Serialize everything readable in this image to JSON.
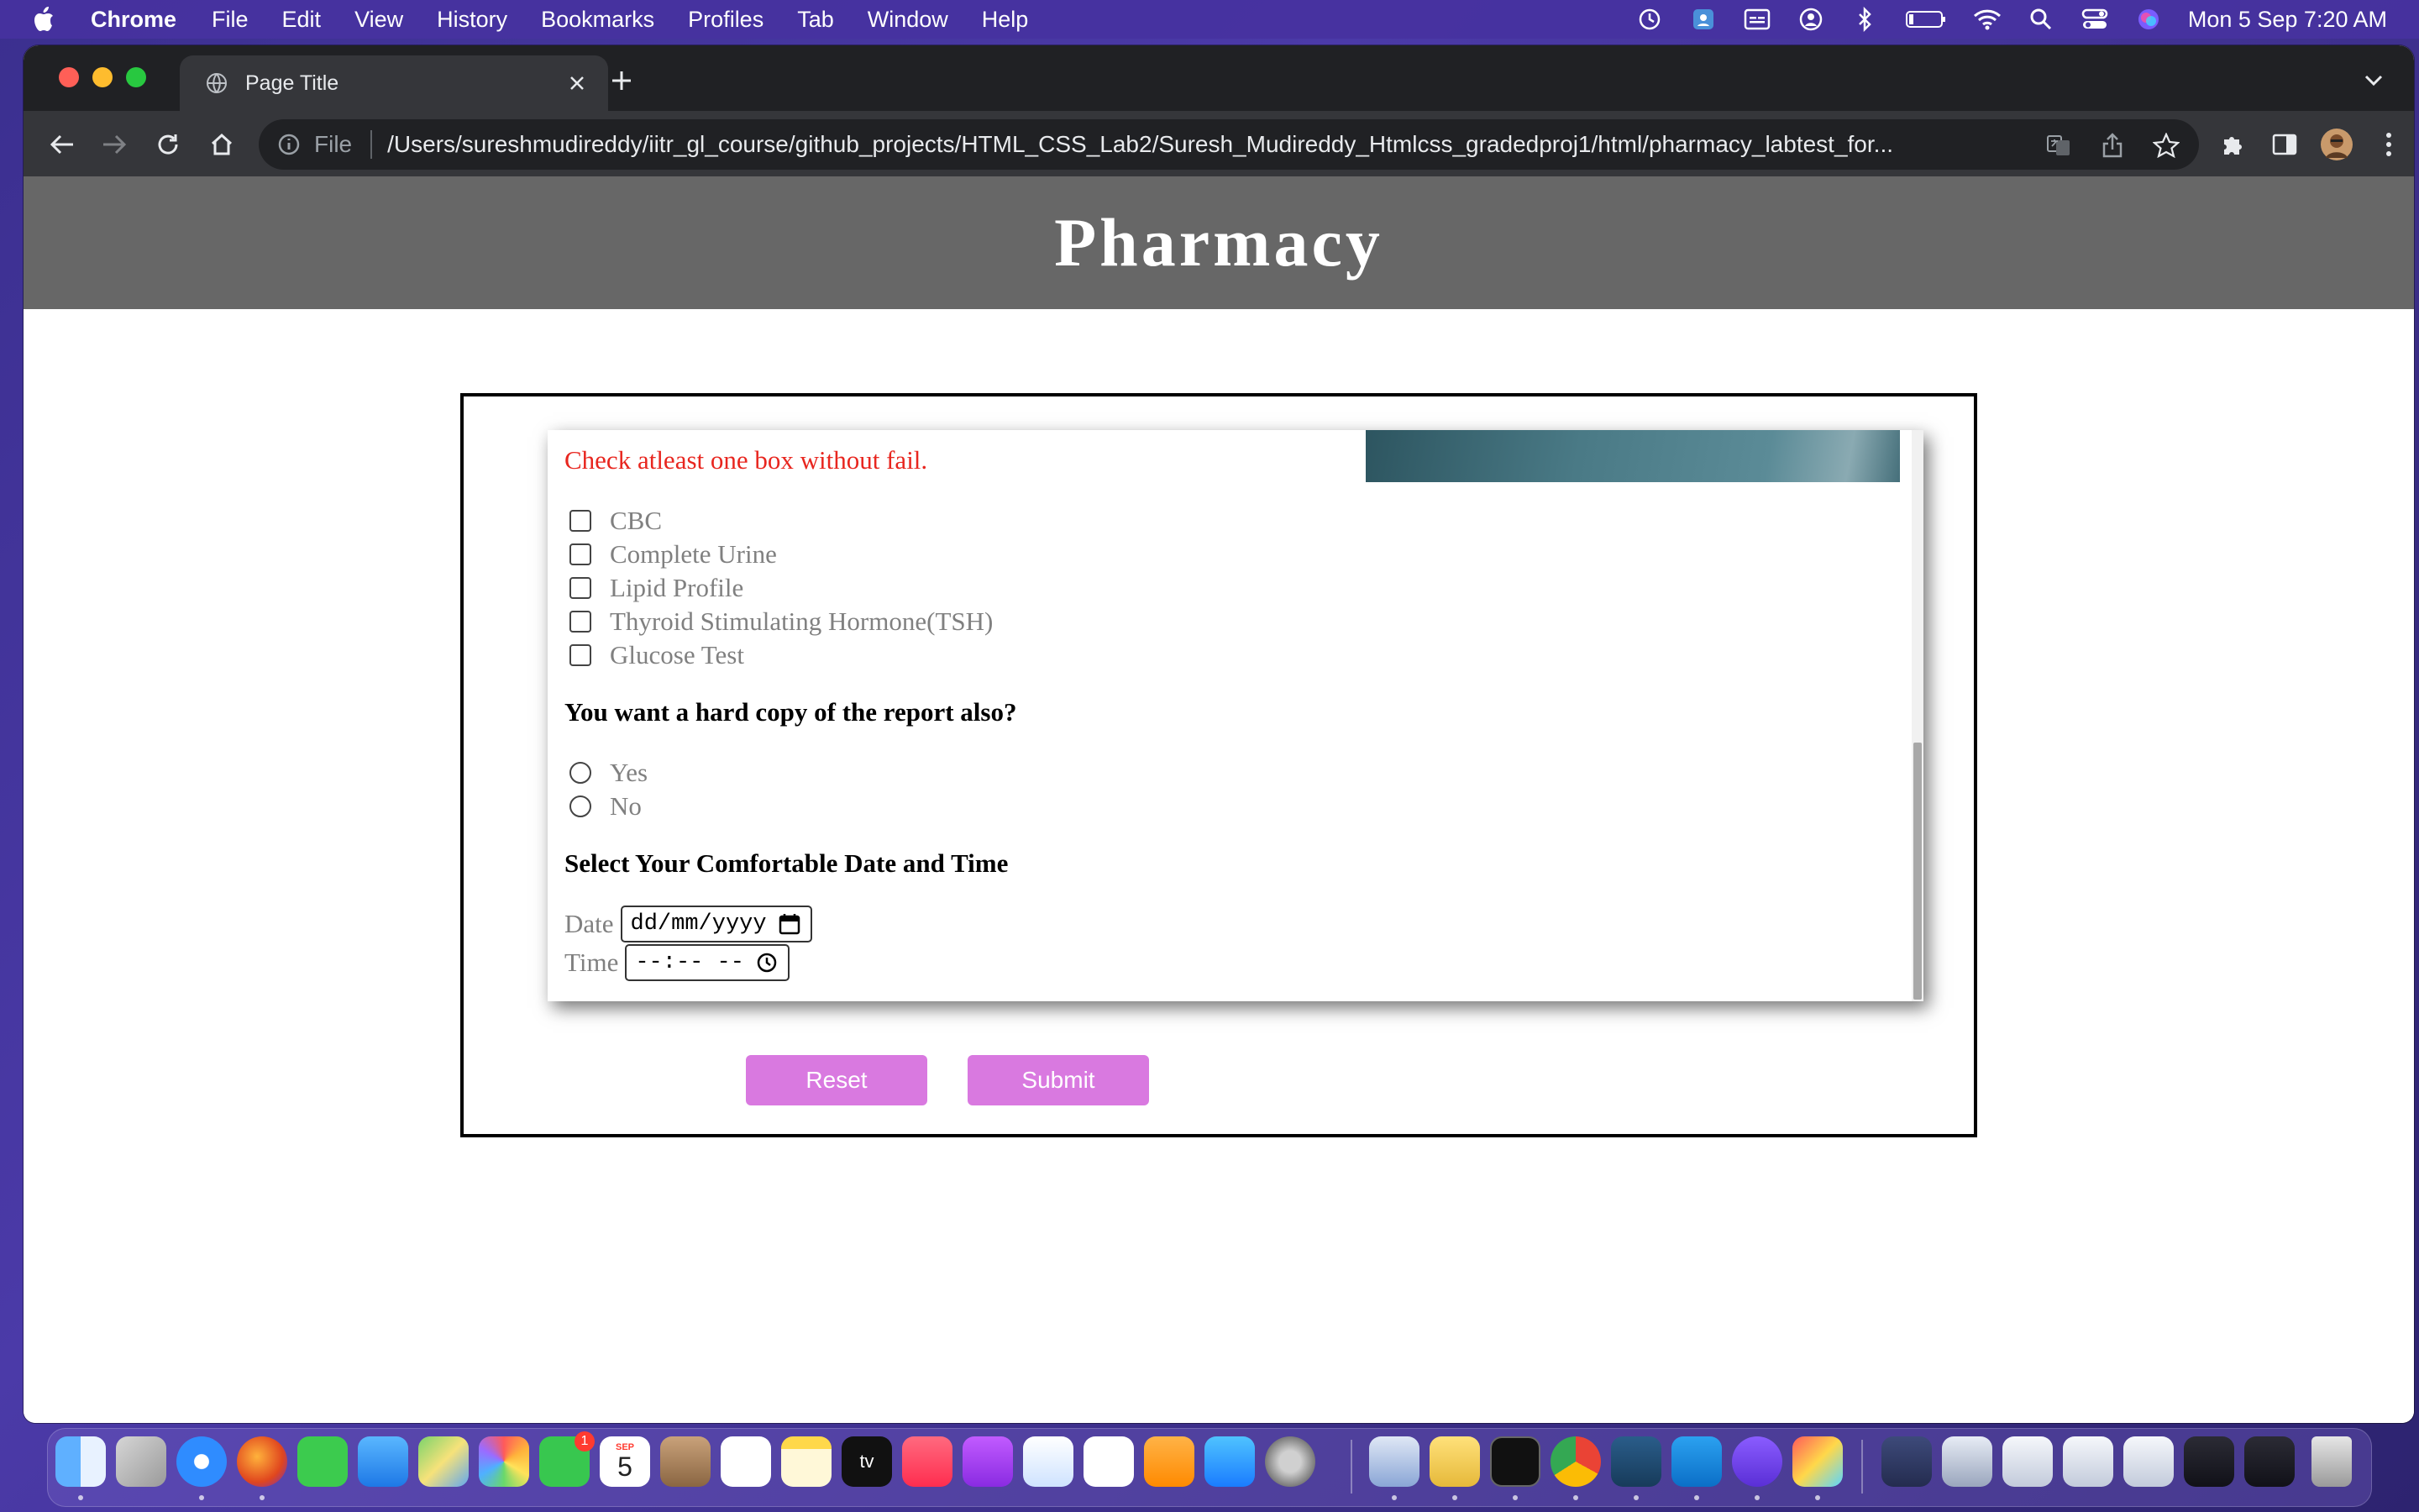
{
  "menubar": {
    "app_name": "Chrome",
    "items": [
      "File",
      "Edit",
      "View",
      "History",
      "Bookmarks",
      "Profiles",
      "Tab",
      "Window",
      "Help"
    ],
    "clock": "Mon 5 Sep  7:20 AM"
  },
  "browser": {
    "tab_title": "Page Title",
    "address_scheme": "File",
    "address_url": "/Users/sureshmudireddy/iitr_gl_course/github_projects/HTML_CSS_Lab2/Suresh_Mudireddy_Htmlcss_gradedproj1/html/pharmacy_labtest_for..."
  },
  "page": {
    "header_title": "Pharmacy",
    "warning": "Check atleast one box without fail.",
    "tests": [
      "CBC",
      "Complete Urine",
      "Lipid Profile",
      "Thyroid Stimulating Hormone(TSH)",
      "Glucose Test"
    ],
    "hardcopy_question": "You want a hard copy of the report also?",
    "hardcopy_options": [
      "Yes",
      "No"
    ],
    "datetime_heading": "Select Your Comfortable Date and Time",
    "date_label": "Date",
    "date_placeholder": "dd/mm/yyyy",
    "time_label": "Time",
    "time_placeholder": "--:-- --",
    "reset_label": "Reset",
    "submit_label": "Submit"
  },
  "dock": {
    "calendar_month": "SEP",
    "calendar_day": "5",
    "facetime_badge": "1",
    "tv_label": "tv"
  },
  "colors": {
    "header_bg": "#676767",
    "warning": "#e8261f",
    "button_bg": "#d979e0",
    "option_text": "#808080"
  }
}
